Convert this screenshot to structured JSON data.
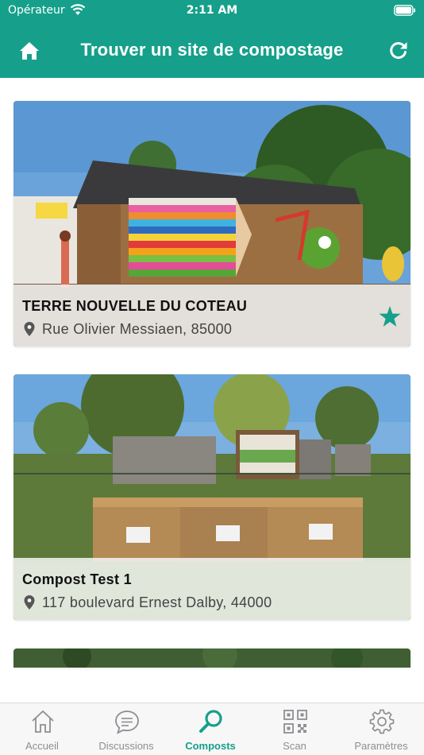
{
  "status_bar": {
    "carrier": "Opérateur",
    "time": "2:11 AM"
  },
  "header": {
    "title": "Trouver un site de compostage"
  },
  "sites": [
    {
      "name": "TERRE NOUVELLE DU COTEAU",
      "address": "Rue Olivier Messiaen, 85000",
      "favorite": true
    },
    {
      "name": "Compost Test 1",
      "address": "117 boulevard Ernest Dalby, 44000",
      "favorite": false
    }
  ],
  "tabbar": {
    "tabs": [
      {
        "label": "Accueil",
        "icon": "home-outline-icon"
      },
      {
        "label": "Discussions",
        "icon": "chat-icon"
      },
      {
        "label": "Composts",
        "icon": "search-icon"
      },
      {
        "label": "Scan",
        "icon": "qr-code-icon"
      },
      {
        "label": "Paramètres",
        "icon": "gear-icon"
      }
    ],
    "active": "Composts"
  },
  "colors": {
    "accent": "#16a08b",
    "tab_inactive": "#8e8e93"
  }
}
